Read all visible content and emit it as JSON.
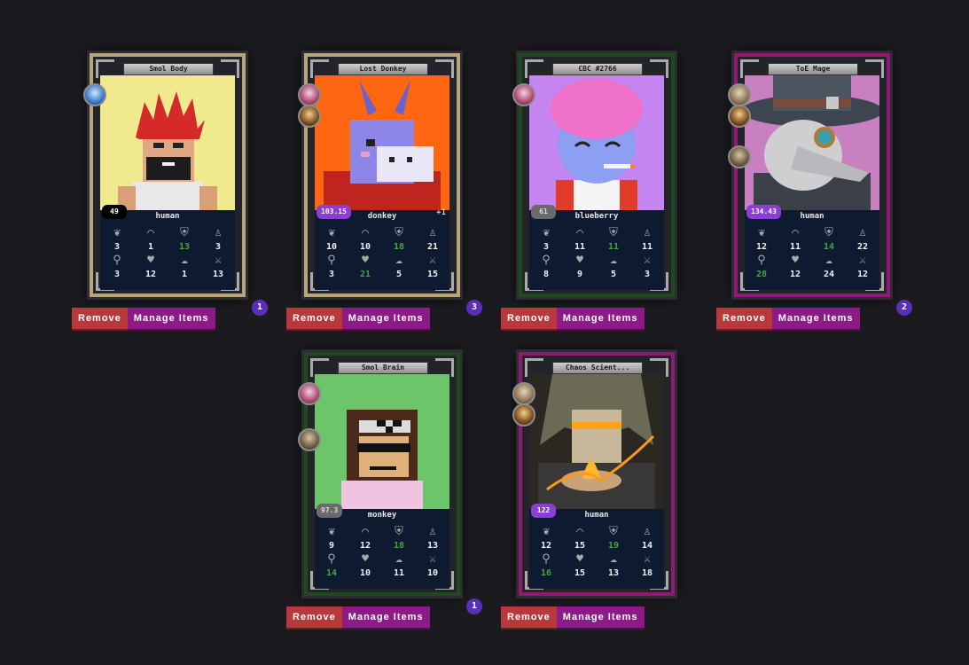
{
  "cards": [
    {
      "title": "Smol Body",
      "race": "human",
      "level": "49",
      "level_style": "black",
      "equip": "",
      "frame": "gold",
      "stats_top": [
        "3",
        "1",
        "13",
        "3"
      ],
      "stats_bottom": [
        "3",
        "12",
        "1",
        "13"
      ],
      "green_top": [
        false,
        false,
        true,
        false
      ],
      "green_bottom": [
        false,
        false,
        false,
        false
      ],
      "badge": "1",
      "avatars": [
        "a1"
      ]
    },
    {
      "title": "Lost Donkey",
      "race": "donkey",
      "level": "103.15",
      "level_style": "purple",
      "equip": "+1",
      "frame": "gold",
      "stats_top": [
        "10",
        "10",
        "18",
        "21"
      ],
      "stats_bottom": [
        "3",
        "21",
        "5",
        "15"
      ],
      "green_top": [
        false,
        false,
        true,
        false
      ],
      "green_bottom": [
        false,
        true,
        false,
        false
      ],
      "badge": "3",
      "avatars": [
        "a2",
        "a3"
      ]
    },
    {
      "title": "CBC #2766",
      "race": "blueberry",
      "level": "61",
      "level_style": "gray",
      "equip": "",
      "frame": "green",
      "stats_top": [
        "3",
        "11",
        "11",
        "11"
      ],
      "stats_bottom": [
        "8",
        "9",
        "5",
        "3"
      ],
      "green_top": [
        false,
        false,
        true,
        false
      ],
      "green_bottom": [
        false,
        false,
        false,
        false
      ],
      "badge": "",
      "avatars": [
        "a2"
      ]
    },
    {
      "title": "ToE Mage",
      "race": "human",
      "level": "134.43",
      "level_style": "purple",
      "equip": "",
      "frame": "purple",
      "stats_top": [
        "12",
        "11",
        "14",
        "22"
      ],
      "stats_bottom": [
        "28",
        "12",
        "24",
        "12"
      ],
      "green_top": [
        false,
        false,
        true,
        false
      ],
      "green_bottom": [
        true,
        false,
        false,
        false
      ],
      "badge": "2",
      "avatars": [
        "a4",
        "a3",
        "a5"
      ]
    },
    {
      "title": "Smol Brain",
      "race": "monkey",
      "level": "97.3",
      "level_style": "gray",
      "equip": "",
      "frame": "green",
      "stats_top": [
        "9",
        "12",
        "18",
        "13"
      ],
      "stats_bottom": [
        "14",
        "10",
        "11",
        "10"
      ],
      "green_top": [
        false,
        false,
        true,
        false
      ],
      "green_bottom": [
        true,
        false,
        false,
        false
      ],
      "badge": "1",
      "avatars": [
        "a2",
        "a5"
      ]
    },
    {
      "title": "Chaos Scient...",
      "race": "human",
      "level": "122",
      "level_style": "purple",
      "equip": "",
      "frame": "purple",
      "stats_top": [
        "12",
        "15",
        "19",
        "14"
      ],
      "stats_bottom": [
        "16",
        "15",
        "13",
        "18"
      ],
      "green_top": [
        false,
        false,
        true,
        false
      ],
      "green_bottom": [
        true,
        false,
        false,
        false
      ],
      "badge": "",
      "avatars": [
        "a4",
        "a3"
      ]
    }
  ],
  "buttons": {
    "remove": "Remove",
    "manage": "Manage Items"
  },
  "icons": {
    "stat_top": [
      "wisdom-icon",
      "hat-icon",
      "shield-icon",
      "figure-icon"
    ],
    "stat_bottom": [
      "potion-icon",
      "heart-icon",
      "brain-icon",
      "swords-icon"
    ]
  },
  "colors": {
    "background": "#1b1b1f",
    "remove": "#b7393b",
    "manage": "#8d1b87",
    "badge": "#5a2fb8",
    "green_stat": "#3fa83f"
  }
}
